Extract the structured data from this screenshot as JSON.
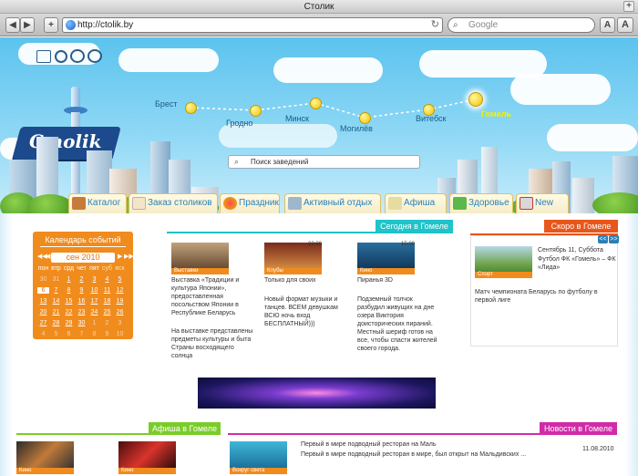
{
  "browser": {
    "window_title": "Столик",
    "url": "http://ctolik.by",
    "search_placeholder": "Google",
    "back_label": "◀",
    "forward_label": "▶",
    "add_label": "+",
    "font_small_label": "A",
    "font_large_label": "A",
    "newtab_label": "+"
  },
  "header": {
    "logo_text": "Cтоlik",
    "search_placeholder": "Поиск заведений",
    "cities": [
      "Брест",
      "Гродно",
      "Минск",
      "Могилёв",
      "Витебск",
      "Гомель"
    ]
  },
  "tabs": [
    "Каталог",
    "Заказ столиков",
    "Праздник",
    "Активный отдых",
    "Афиша",
    "Здоровье",
    "New"
  ],
  "calendar": {
    "title": "Календарь событий",
    "month": "сен 2010",
    "weekdays": [
      "пон",
      "втр",
      "срд",
      "чет",
      "пят",
      "суб",
      "вск"
    ],
    "weeks": [
      [
        "30",
        "31",
        "1",
        "2",
        "3",
        "4",
        "5"
      ],
      [
        "6",
        "7",
        "8",
        "9",
        "10",
        "11",
        "12"
      ],
      [
        "13",
        "14",
        "15",
        "16",
        "17",
        "18",
        "19"
      ],
      [
        "20",
        "21",
        "22",
        "23",
        "24",
        "25",
        "26"
      ],
      [
        "27",
        "28",
        "29",
        "30",
        "1",
        "2",
        "3"
      ],
      [
        "4",
        "5",
        "6",
        "7",
        "8",
        "9",
        "10"
      ]
    ],
    "today": "6"
  },
  "today_section": {
    "heading": "Сегодня в Гомеле",
    "items": [
      {
        "category": "Выставки",
        "time": "",
        "title": "Выставка «Традиции и культура Японии», предоставленная посольством Японии в Республике Беларусь",
        "text": "На выставке представлены предметы культуры и быта Страны восходящего солнца"
      },
      {
        "category": "Клубы",
        "time": "22:00",
        "title": "Только для своих",
        "text": "Новый формат музыки и танцев. ВСЕМ девушкам ВСЮ ночь вход БЕСПЛАТНЫЙ)))"
      },
      {
        "category": "Кино",
        "time": "15:00",
        "title": "Пиранья 3D",
        "text": "Подземный толчок разбудил живущих на дне озера Виктория доисторических пираний. Местный шериф готов на все, чтобы спасти жителей своего города."
      }
    ]
  },
  "soon_section": {
    "heading": "Скоро в Гомеле",
    "category": "Спорт",
    "date": "Сентябрь 11, Суббота",
    "title": "Футбол ФК «Гомель» – ФК «Лида»",
    "text": "Матч чемпионата Беларусь по футболу в первой лиге",
    "prev_label": "<<",
    "next_label": ">>"
  },
  "afisha_section": {
    "heading": "Афиша в Гомеле",
    "items": [
      {
        "category": "Кино"
      },
      {
        "category": "Кино"
      }
    ]
  },
  "news_section": {
    "heading": "Новости в Гомеле",
    "category": "Вокруг света",
    "title": "Первый в мире подводный ресторан на Маль",
    "text": "Первый в мире подводный ресторан в мире, был открыт на Мальдивских ...",
    "date": "11.08.2010"
  },
  "colors": {
    "accent_orange": "#f08b1d",
    "accent_teal": "#1fc3c9",
    "accent_red": "#e8561a",
    "accent_green": "#7bcc2a",
    "accent_magenta": "#d12ca8",
    "link_blue": "#2a7fb8"
  }
}
